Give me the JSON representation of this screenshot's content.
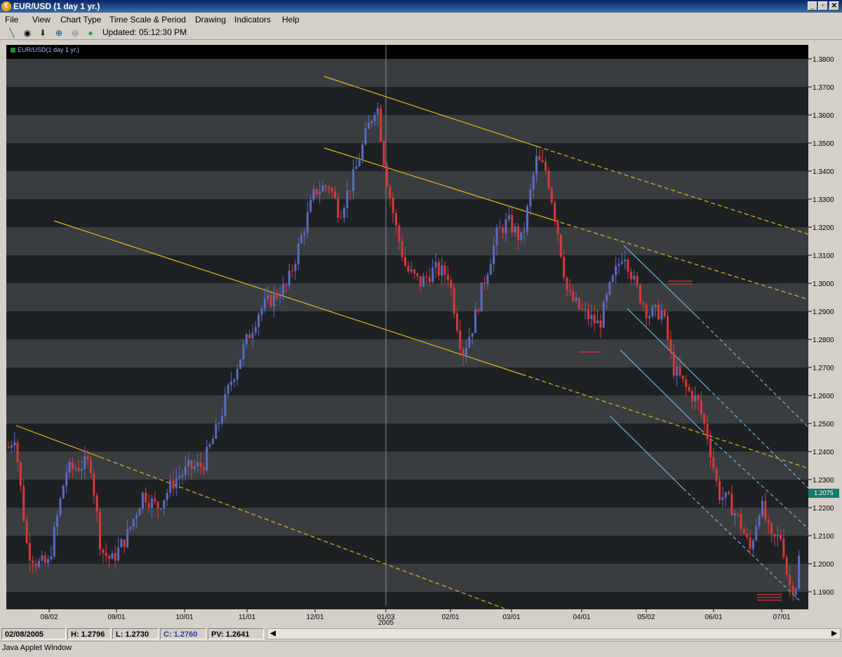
{
  "window": {
    "title": "EUR/USD (1 day  1 yr.)",
    "buttons": [
      "_",
      "▫",
      "✕"
    ]
  },
  "menu": [
    "File",
    "View",
    "Chart Type",
    "Time Scale & Period",
    "Drawing",
    "Indicators",
    "Help"
  ],
  "toolbar": {
    "icons": [
      "pen-icon",
      "target-icon",
      "down-arrow-icon",
      "zoom-in-icon",
      "zoom-out-icon",
      "green-dot-icon"
    ],
    "updated": "Updated: 05:12:30 PM"
  },
  "chart": {
    "legend": "EUR/USD(1 day  1 yr.)",
    "last_price": "1.2075",
    "accent": {
      "up": "#5c6bc0",
      "down": "#d63a3a",
      "trend": "#e6b422",
      "channel": "#6fb8e0"
    }
  },
  "chart_data": {
    "type": "candlestick",
    "title": "EUR/USD(1 day  1 yr.)",
    "y_ticks": [
      "1.3800",
      "1.3700",
      "1.3600",
      "1.3500",
      "1.3400",
      "1.3300",
      "1.3200",
      "1.3100",
      "1.3000",
      "1.2900",
      "1.2800",
      "1.2700",
      "1.2600",
      "1.2500",
      "1.2400",
      "1.2300",
      "1.2200",
      "1.2100",
      "1.2000",
      "1.1900"
    ],
    "x_ticks": [
      "08/02",
      "09/01",
      "10/01",
      "11/01",
      "12/01",
      "01/03",
      "02/01",
      "03/01",
      "04/01",
      "05/02",
      "06/01",
      "07/01"
    ],
    "x_sublabel": "2005",
    "ylim": [
      1.185,
      1.385
    ],
    "close_path": [
      {
        "x": 0,
        "y": 1.24
      },
      {
        "x": 12,
        "y": 1.246
      },
      {
        "x": 30,
        "y": 1.205
      },
      {
        "x": 45,
        "y": 1.2
      },
      {
        "x": 60,
        "y": 1.2
      },
      {
        "x": 85,
        "y": 1.233
      },
      {
        "x": 105,
        "y": 1.235
      },
      {
        "x": 120,
        "y": 1.236
      },
      {
        "x": 135,
        "y": 1.205
      },
      {
        "x": 150,
        "y": 1.201
      },
      {
        "x": 172,
        "y": 1.21
      },
      {
        "x": 195,
        "y": 1.225
      },
      {
        "x": 215,
        "y": 1.22
      },
      {
        "x": 240,
        "y": 1.23
      },
      {
        "x": 260,
        "y": 1.234
      },
      {
        "x": 280,
        "y": 1.235
      },
      {
        "x": 300,
        "y": 1.248
      },
      {
        "x": 320,
        "y": 1.265
      },
      {
        "x": 340,
        "y": 1.278
      },
      {
        "x": 360,
        "y": 1.29
      },
      {
        "x": 380,
        "y": 1.295
      },
      {
        "x": 400,
        "y": 1.299
      },
      {
        "x": 420,
        "y": 1.316
      },
      {
        "x": 440,
        "y": 1.333
      },
      {
        "x": 460,
        "y": 1.335
      },
      {
        "x": 475,
        "y": 1.325
      },
      {
        "x": 495,
        "y": 1.338
      },
      {
        "x": 515,
        "y": 1.355
      },
      {
        "x": 528,
        "y": 1.365
      },
      {
        "x": 540,
        "y": 1.34
      },
      {
        "x": 555,
        "y": 1.32
      },
      {
        "x": 570,
        "y": 1.305
      },
      {
        "x": 590,
        "y": 1.3
      },
      {
        "x": 610,
        "y": 1.305
      },
      {
        "x": 630,
        "y": 1.303
      },
      {
        "x": 650,
        "y": 1.275
      },
      {
        "x": 665,
        "y": 1.285
      },
      {
        "x": 680,
        "y": 1.3
      },
      {
        "x": 700,
        "y": 1.318
      },
      {
        "x": 715,
        "y": 1.322
      },
      {
        "x": 735,
        "y": 1.315
      },
      {
        "x": 755,
        "y": 1.344
      },
      {
        "x": 770,
        "y": 1.34
      },
      {
        "x": 785,
        "y": 1.32
      },
      {
        "x": 800,
        "y": 1.296
      },
      {
        "x": 820,
        "y": 1.29
      },
      {
        "x": 845,
        "y": 1.285
      },
      {
        "x": 860,
        "y": 1.298
      },
      {
        "x": 880,
        "y": 1.312
      },
      {
        "x": 895,
        "y": 1.3
      },
      {
        "x": 915,
        "y": 1.289
      },
      {
        "x": 935,
        "y": 1.29
      },
      {
        "x": 950,
        "y": 1.27
      },
      {
        "x": 970,
        "y": 1.262
      },
      {
        "x": 985,
        "y": 1.258
      },
      {
        "x": 1000,
        "y": 1.245
      },
      {
        "x": 1015,
        "y": 1.225
      },
      {
        "x": 1030,
        "y": 1.222
      },
      {
        "x": 1045,
        "y": 1.215
      },
      {
        "x": 1060,
        "y": 1.205
      },
      {
        "x": 1075,
        "y": 1.222
      },
      {
        "x": 1090,
        "y": 1.208
      },
      {
        "x": 1105,
        "y": 1.21
      },
      {
        "x": 1115,
        "y": 1.192
      },
      {
        "x": 1125,
        "y": 1.192
      },
      {
        "x": 1132,
        "y": 1.207
      }
    ]
  },
  "status": {
    "date": "02/08/2005",
    "high": "H: 1.2796",
    "low": "L: 1.2730",
    "close": "C: 1.2760",
    "pv": "PV: 1.2641"
  },
  "footer": {
    "text": "Java Applet Window"
  }
}
